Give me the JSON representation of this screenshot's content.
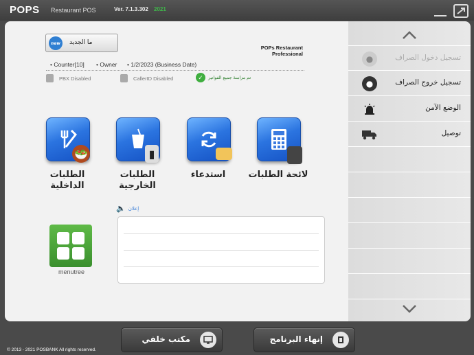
{
  "header": {
    "logo": "POPS",
    "logo_sub": "Restaurant POS",
    "version": "Ver. 7.1.3.302",
    "year": "2021"
  },
  "main": {
    "new_badge": "new",
    "new_button": "ما الجديد",
    "store_name_line1": "POPs Restaurant",
    "store_name_line2": "Professional",
    "counter": "• Counter[10]",
    "owner": "• Owner",
    "business_date": "• 1/2/2023 (Business Date)",
    "pbx": "PBX Disabled",
    "callerid": "CallerID Disabled",
    "sync": "تم مزامنة جميع الفواتير",
    "tiles": [
      {
        "label": "الطلبات الداخلية"
      },
      {
        "label": "الطلبات الخارجية"
      },
      {
        "label": "استدعاء"
      },
      {
        "label": "لائحة الطلبات"
      }
    ],
    "notice_label": "إعلان",
    "menutree": "menutree"
  },
  "sidebar": {
    "items": [
      {
        "label": "تسجيل دخول الصراف",
        "disabled": true
      },
      {
        "label": "تسجيل خروج الصراف",
        "disabled": false
      },
      {
        "label": "الوضع الآمن",
        "disabled": false
      },
      {
        "label": "توصيل",
        "disabled": false
      }
    ]
  },
  "footer": {
    "back_office": "مكتب خلفي",
    "exit": "إنهاء البرنامج",
    "copyright": "© 2013 - 2021 POSBANK All rights reserved."
  }
}
